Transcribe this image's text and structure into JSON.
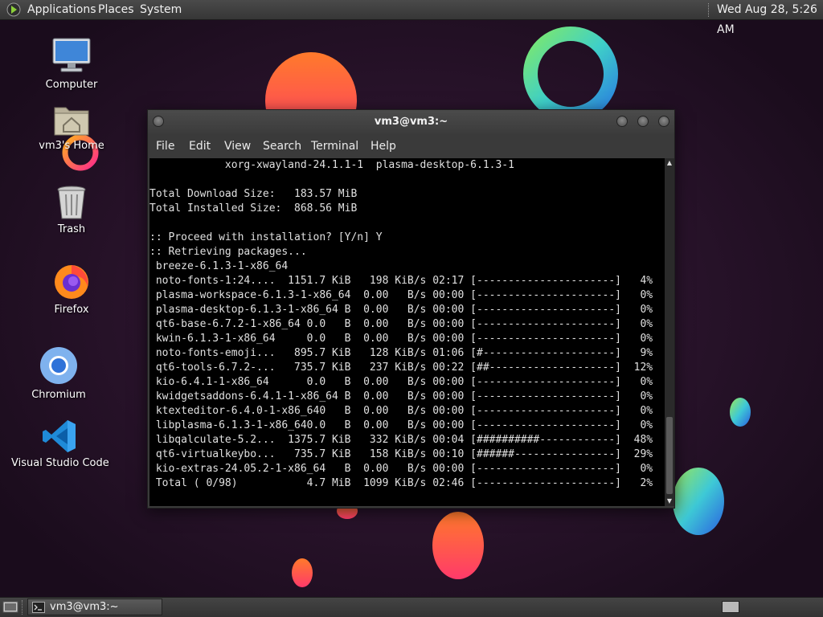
{
  "top_panel": {
    "menus": [
      "Applications",
      "Places",
      "System"
    ],
    "clock": "Wed Aug 28,  5:26 AM"
  },
  "desktop_icons": [
    {
      "label": "Computer",
      "icon": "computer-icon"
    },
    {
      "label": "vm3's Home",
      "icon": "home-folder-icon"
    },
    {
      "label": "Trash",
      "icon": "trash-icon"
    },
    {
      "label": "Firefox",
      "icon": "firefox-icon"
    },
    {
      "label": "Chromium",
      "icon": "chromium-icon"
    },
    {
      "label": "Visual Studio Code",
      "icon": "vscode-icon"
    }
  ],
  "terminal": {
    "title": "vm3@vm3:~",
    "menu": [
      "File",
      "Edit",
      "View",
      "Search",
      "Terminal",
      "Help"
    ],
    "lines": [
      "            xorg-xwayland-24.1.1-1  plasma-desktop-6.1.3-1",
      "",
      "Total Download Size:   183.57 MiB",
      "Total Installed Size:  868.56 MiB",
      "",
      ":: Proceed with installation? [Y/n] Y",
      ":: Retrieving packages...",
      " breeze-6.1.3-1-x86_64",
      " noto-fonts-1:24....  1151.7 KiB   198 KiB/s 02:17 [----------------------]   4%",
      " plasma-workspace-6.1.3-1-x86_64  0.00   B/s 00:00 [----------------------]   0%",
      " plasma-desktop-6.1.3-1-x86_64 B  0.00   B/s 00:00 [----------------------]   0%",
      " qt6-base-6.7.2-1-x86_64 0.0   B  0.00   B/s 00:00 [----------------------]   0%",
      " kwin-6.1.3-1-x86_64     0.0   B  0.00   B/s 00:00 [----------------------]   0%",
      " noto-fonts-emoji...   895.7 KiB   128 KiB/s 01:06 [#---------------------]   9%",
      " qt6-tools-6.7.2-...   735.7 KiB   237 KiB/s 00:22 [##--------------------]  12%",
      " kio-6.4.1-1-x86_64      0.0   B  0.00   B/s 00:00 [----------------------]   0%",
      " kwidgetsaddons-6.4.1-1-x86_64 B  0.00   B/s 00:00 [----------------------]   0%",
      " ktexteditor-6.4.0-1-x86_640   B  0.00   B/s 00:00 [----------------------]   0%",
      " libplasma-6.1.3-1-x86_640.0   B  0.00   B/s 00:00 [----------------------]   0%",
      " libqalculate-5.2...  1375.7 KiB   332 KiB/s 00:04 [##########------------]  48%",
      " qt6-virtualkeybo...   735.7 KiB   158 KiB/s 00:10 [######----------------]  29%",
      " kio-extras-24.05.2-1-x86_64   B  0.00   B/s 00:00 [----------------------]   0%",
      " Total ( 0/98)           4.7 MiB  1099 KiB/s 02:46 [----------------------]   2%"
    ]
  },
  "taskbar": {
    "items": [
      {
        "label": "vm3@vm3:~",
        "icon": "terminal-icon"
      }
    ]
  },
  "colors": {
    "panel": "#3c3c3c",
    "terminal_bg": "#000000",
    "terminal_fg": "#e0e0e0",
    "wallpaper": "#1f0f22"
  }
}
